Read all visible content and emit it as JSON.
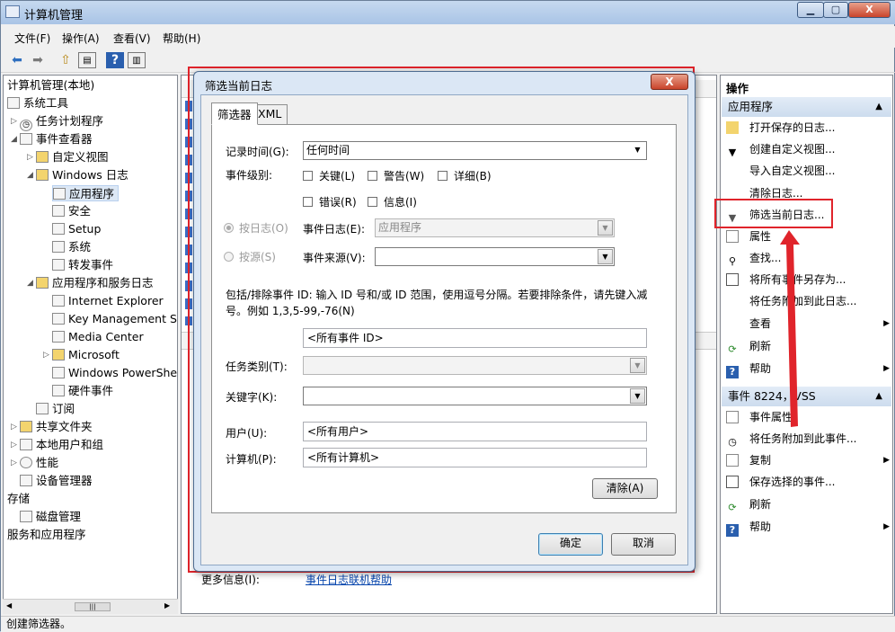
{
  "window": {
    "title": "计算机管理"
  },
  "menu": [
    "文件(F)",
    "操作(A)",
    "查看(V)",
    "帮助(H)"
  ],
  "tree": [
    {
      "label": "计算机管理(本地)"
    },
    {
      "label": "系统工具"
    },
    {
      "label": "任务计划程序"
    },
    {
      "label": "事件查看器"
    },
    {
      "label": "自定义视图"
    },
    {
      "label": "Windows 日志"
    },
    {
      "label": "应用程序"
    },
    {
      "label": "安全"
    },
    {
      "label": "Setup"
    },
    {
      "label": "系统"
    },
    {
      "label": "转发事件"
    },
    {
      "label": "应用程序和服务日志"
    },
    {
      "label": "Internet Explorer"
    },
    {
      "label": "Key Management Se"
    },
    {
      "label": "Media Center"
    },
    {
      "label": "Microsoft"
    },
    {
      "label": "Windows PowerShel"
    },
    {
      "label": "硬件事件"
    },
    {
      "label": "订阅"
    },
    {
      "label": "共享文件夹"
    },
    {
      "label": "本地用户和组"
    },
    {
      "label": "性能"
    },
    {
      "label": "设备管理器"
    },
    {
      "label": "存储"
    },
    {
      "label": "磁盘管理"
    },
    {
      "label": "服务和应用程序"
    }
  ],
  "center": {
    "more_info_label": "更多信息(I):",
    "more_info_link": "事件日志联机帮助"
  },
  "actions": {
    "header": "操作",
    "section1": "应用程序",
    "items1": [
      "打开保存的日志...",
      "创建自定义视图...",
      "导入自定义视图...",
      "清除日志...",
      "筛选当前日志...",
      "属性",
      "查找...",
      "将所有事件另存为...",
      "将任务附加到此日志...",
      "查看",
      "刷新",
      "帮助"
    ],
    "section2": "事件 8224，VSS",
    "items2": [
      "事件属性",
      "将任务附加到此事件...",
      "复制",
      "保存选择的事件...",
      "刷新",
      "帮助"
    ]
  },
  "status": "创建筛选器。",
  "dialog": {
    "title": "筛选当前日志",
    "close": "X",
    "tabs": [
      "筛选器",
      "XML"
    ],
    "logged_label": "记录时间(G):",
    "logged_value": "任何时间",
    "level_label": "事件级别:",
    "levels": [
      "关键(L)",
      "警告(W)",
      "详细(B)",
      "错误(R)",
      "信息(I)"
    ],
    "by_log": "按日志(O)",
    "by_source": "按源(S)",
    "event_logs_label": "事件日志(E):",
    "event_logs_value": "应用程序",
    "event_source_label": "事件来源(V):",
    "event_source_value": "",
    "id_help": "包括/排除事件 ID: 输入 ID 号和/或 ID 范围，使用逗号分隔。若要排除条件，请先键入减",
    "id_help2": "号。例如 1,3,5-99,-76(N)",
    "event_ids": "<所有事件 ID>",
    "task_label": "任务类别(T):",
    "task_value": "",
    "keywords_label": "关键字(K):",
    "keywords_value": "",
    "user_label": "用户(U):",
    "user_value": "<所有用户>",
    "computer_label": "计算机(P):",
    "computer_value": "<所有计算机>",
    "clear_btn": "清除(A)",
    "ok_btn": "确定",
    "cancel_btn": "取消"
  },
  "colors": {
    "highlight": "#e0242b",
    "accent": "#3c7fb1"
  }
}
